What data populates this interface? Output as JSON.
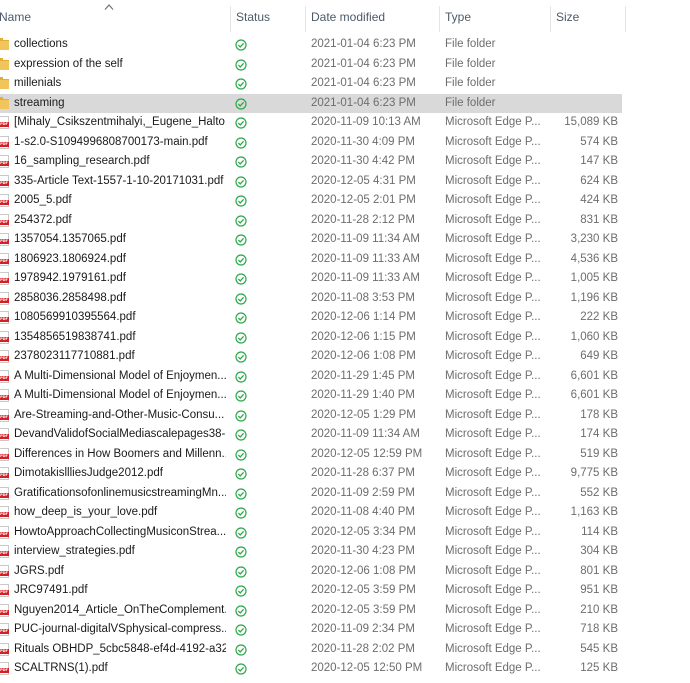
{
  "columns": {
    "name": "Name",
    "status": "Status",
    "date_modified": "Date modified",
    "type": "Type",
    "size": "Size"
  },
  "accent_colors": {
    "status_check": "#2aa84a",
    "selected_row": "#d9d9d9",
    "pdf_icon": "#d51f26",
    "folder_icon": "#f2c55c"
  },
  "files": [
    {
      "icon": "folder-icon",
      "name": "collections",
      "date": "2021-01-04 6:23 PM",
      "type": "File folder",
      "size": ""
    },
    {
      "icon": "folder-icon",
      "name": "expression of the self",
      "date": "2021-01-04 6:23 PM",
      "type": "File folder",
      "size": ""
    },
    {
      "icon": "folder-icon",
      "name": "millenials",
      "date": "2021-01-04 6:23 PM",
      "type": "File folder",
      "size": ""
    },
    {
      "icon": "folder-icon",
      "name": "streaming",
      "date": "2021-01-04 6:23 PM",
      "type": "File folder",
      "size": "",
      "selected": true
    },
    {
      "icon": "pdf-icon",
      "name": "[Mihaly_Csikszentmihalyi,_Eugene_Halto...",
      "date": "2020-11-09 10:13 AM",
      "type": "Microsoft Edge P...",
      "size": "15,089 KB"
    },
    {
      "icon": "pdf-icon",
      "name": "1-s2.0-S1094996808700173-main.pdf",
      "date": "2020-11-30 4:09 PM",
      "type": "Microsoft Edge P...",
      "size": "574 KB"
    },
    {
      "icon": "pdf-icon",
      "name": "16_sampling_research.pdf",
      "date": "2020-11-30 4:42 PM",
      "type": "Microsoft Edge P...",
      "size": "147 KB"
    },
    {
      "icon": "pdf-icon",
      "name": "335-Article Text-1557-1-10-20171031.pdf",
      "date": "2020-12-05 4:31 PM",
      "type": "Microsoft Edge P...",
      "size": "624 KB"
    },
    {
      "icon": "pdf-icon",
      "name": "2005_5.pdf",
      "date": "2020-12-05 2:01 PM",
      "type": "Microsoft Edge P...",
      "size": "424 KB"
    },
    {
      "icon": "pdf-icon",
      "name": "254372.pdf",
      "date": "2020-11-28 2:12 PM",
      "type": "Microsoft Edge P...",
      "size": "831 KB"
    },
    {
      "icon": "pdf-icon",
      "name": "1357054.1357065.pdf",
      "date": "2020-11-09 11:34 AM",
      "type": "Microsoft Edge P...",
      "size": "3,230 KB"
    },
    {
      "icon": "pdf-icon",
      "name": "1806923.1806924.pdf",
      "date": "2020-11-09 11:33 AM",
      "type": "Microsoft Edge P...",
      "size": "4,536 KB"
    },
    {
      "icon": "pdf-icon",
      "name": "1978942.1979161.pdf",
      "date": "2020-11-09 11:33 AM",
      "type": "Microsoft Edge P...",
      "size": "1,005 KB"
    },
    {
      "icon": "pdf-icon",
      "name": "2858036.2858498.pdf",
      "date": "2020-11-08 3:53 PM",
      "type": "Microsoft Edge P...",
      "size": "1,196 KB"
    },
    {
      "icon": "pdf-icon",
      "name": "1080569910395564.pdf",
      "date": "2020-12-06 1:14 PM",
      "type": "Microsoft Edge P...",
      "size": "222 KB"
    },
    {
      "icon": "pdf-icon",
      "name": "1354856519838741.pdf",
      "date": "2020-12-06 1:15 PM",
      "type": "Microsoft Edge P...",
      "size": "1,060 KB"
    },
    {
      "icon": "pdf-icon",
      "name": "2378023117710881.pdf",
      "date": "2020-12-06 1:08 PM",
      "type": "Microsoft Edge P...",
      "size": "649 KB"
    },
    {
      "icon": "pdf-icon",
      "name": "A Multi-Dimensional Model of Enjoymen...",
      "date": "2020-11-29 1:45 PM",
      "type": "Microsoft Edge P...",
      "size": "6,601 KB"
    },
    {
      "icon": "pdf-icon",
      "name": "A Multi-Dimensional Model of Enjoymen...",
      "date": "2020-11-29 1:40 PM",
      "type": "Microsoft Edge P...",
      "size": "6,601 KB"
    },
    {
      "icon": "pdf-icon",
      "name": "Are-Streaming-and-Other-Music-Consu...",
      "date": "2020-12-05 1:29 PM",
      "type": "Microsoft Edge P...",
      "size": "178 KB"
    },
    {
      "icon": "pdf-icon",
      "name": "DevandValidofSocialMediascalepages38-...",
      "date": "2020-11-09 11:34 AM",
      "type": "Microsoft Edge P...",
      "size": "174 KB"
    },
    {
      "icon": "pdf-icon",
      "name": "Differences in How Boomers and Millenn...",
      "date": "2020-12-05 12:59 PM",
      "type": "Microsoft Edge P...",
      "size": "519 KB"
    },
    {
      "icon": "pdf-icon",
      "name": "DimotakisllliesJudge2012.pdf",
      "date": "2020-11-28 6:37 PM",
      "type": "Microsoft Edge P...",
      "size": "9,775 KB"
    },
    {
      "icon": "pdf-icon",
      "name": "GratificationsofonlinemusicstreamingMn...",
      "date": "2020-11-09 2:59 PM",
      "type": "Microsoft Edge P...",
      "size": "552 KB"
    },
    {
      "icon": "pdf-icon",
      "name": "how_deep_is_your_love.pdf",
      "date": "2020-11-08 4:40 PM",
      "type": "Microsoft Edge P...",
      "size": "1,163 KB"
    },
    {
      "icon": "pdf-icon",
      "name": "HowtoApproachCollectingMusiconStrea...",
      "date": "2020-12-05 3:34 PM",
      "type": "Microsoft Edge P...",
      "size": "114 KB"
    },
    {
      "icon": "pdf-icon",
      "name": "interview_strategies.pdf",
      "date": "2020-11-30 4:23 PM",
      "type": "Microsoft Edge P...",
      "size": "304 KB"
    },
    {
      "icon": "pdf-icon",
      "name": "JGRS.pdf",
      "date": "2020-12-06 1:08 PM",
      "type": "Microsoft Edge P...",
      "size": "801 KB"
    },
    {
      "icon": "pdf-icon",
      "name": "JRC97491.pdf",
      "date": "2020-12-05 3:59 PM",
      "type": "Microsoft Edge P...",
      "size": "951 KB"
    },
    {
      "icon": "pdf-icon",
      "name": "Nguyen2014_Article_OnTheComplement...",
      "date": "2020-12-05 3:59 PM",
      "type": "Microsoft Edge P...",
      "size": "210 KB"
    },
    {
      "icon": "pdf-icon",
      "name": "PUC-journal-digitalVSphysical-compress...",
      "date": "2020-11-09 2:34 PM",
      "type": "Microsoft Edge P...",
      "size": "718 KB"
    },
    {
      "icon": "pdf-icon",
      "name": "Rituals OBHDP_5cbc5848-ef4d-4192-a32...",
      "date": "2020-11-28 2:02 PM",
      "type": "Microsoft Edge P...",
      "size": "545 KB"
    },
    {
      "icon": "pdf-icon",
      "name": "SCALTRNS(1).pdf",
      "date": "2020-12-05 12:50 PM",
      "type": "Microsoft Edge P...",
      "size": "125 KB"
    }
  ]
}
